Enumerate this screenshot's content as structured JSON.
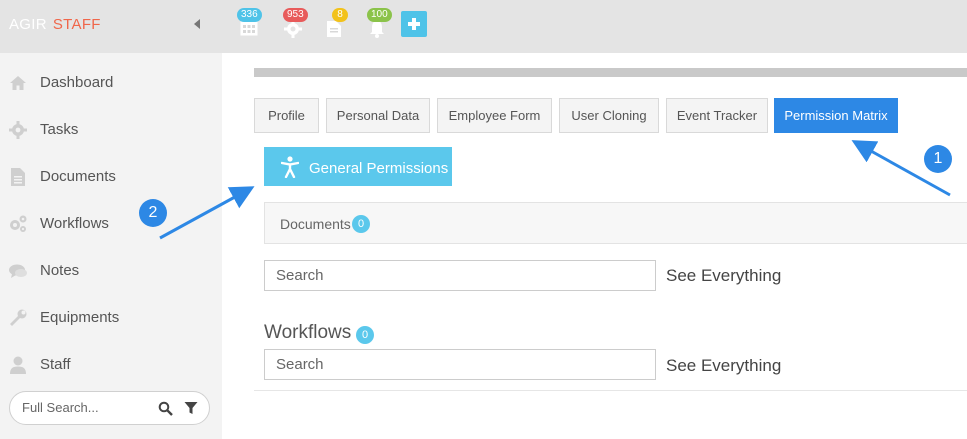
{
  "brand": {
    "part1": "AGIR",
    "part2": "STAFF"
  },
  "toolbar": {
    "badges": [
      {
        "icon": "calendar-icon",
        "count": "336",
        "color": "#4fc3e8"
      },
      {
        "icon": "gear-icon",
        "count": "953",
        "color": "#e85b5b"
      },
      {
        "icon": "document-icon",
        "count": "8",
        "color": "#f2c21b"
      },
      {
        "icon": "bell-icon",
        "count": "100",
        "color": "#8bc34a"
      }
    ],
    "add_icon": "plus-icon"
  },
  "sidebar": {
    "items": [
      {
        "label": "Dashboard",
        "icon": "home-icon"
      },
      {
        "label": "Tasks",
        "icon": "gear-icon"
      },
      {
        "label": "Documents",
        "icon": "document-icon"
      },
      {
        "label": "Workflows",
        "icon": "gears-icon"
      },
      {
        "label": "Notes",
        "icon": "comments-icon"
      },
      {
        "label": "Equipments",
        "icon": "wrench-icon"
      },
      {
        "label": "Staff",
        "icon": "user-icon"
      }
    ],
    "search_placeholder": "Full Search..."
  },
  "tabs": [
    {
      "label": "Profile"
    },
    {
      "label": "Personal Data"
    },
    {
      "label": "Employee Form"
    },
    {
      "label": "User Cloning"
    },
    {
      "label": "Event Tracker"
    },
    {
      "label": "Permission Matrix",
      "active": true
    }
  ],
  "general_permissions": {
    "label": "General Permissions",
    "icon": "accessibility-icon"
  },
  "documents": {
    "label": "Documents",
    "count": "0",
    "search_placeholder": "Search",
    "see_everything": "See Everything"
  },
  "workflows": {
    "label": "Workflows",
    "count": "0",
    "search_placeholder": "Search",
    "see_everything": "See Everything"
  },
  "annotations": {
    "marker1": "1",
    "marker2": "2"
  },
  "colors": {
    "accent": "#2d88e5",
    "light_blue": "#5bc8ec",
    "brand_orange": "#f0664a"
  }
}
